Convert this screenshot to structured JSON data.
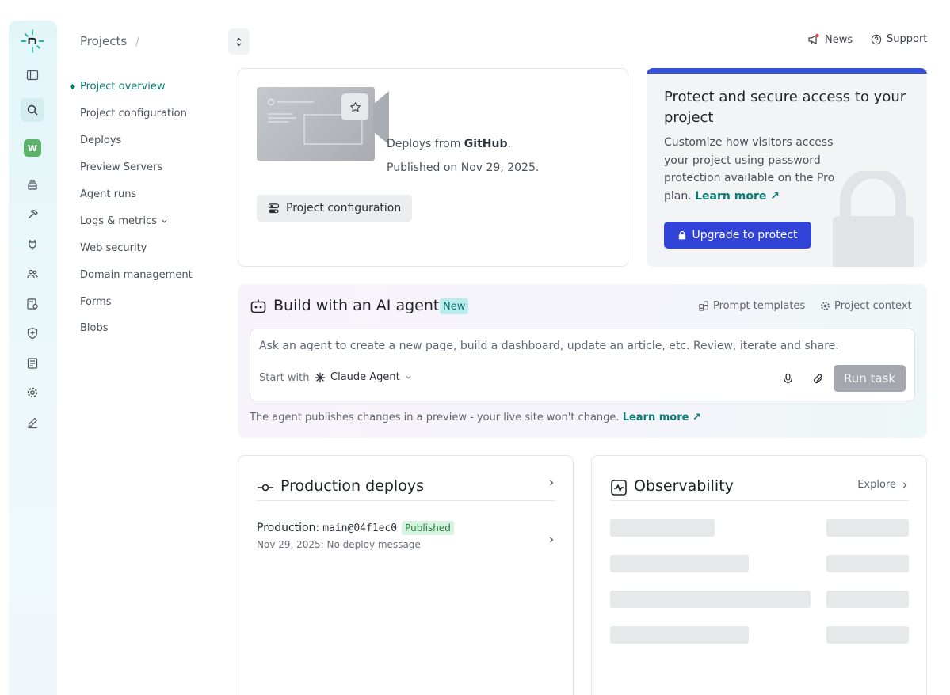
{
  "header": {
    "breadcrumb": "Projects",
    "breadcrumb_sep": "/",
    "news": "News",
    "support": "Support"
  },
  "nav": {
    "items": [
      "Project overview",
      "Project configuration",
      "Deploys",
      "Preview Servers",
      "Agent runs",
      "Logs & metrics",
      "Web security",
      "Domain management",
      "Forms",
      "Blobs"
    ]
  },
  "rail": {
    "avatar_letter": "W"
  },
  "overview": {
    "deploys_from_prefix": "Deploys from ",
    "deploys_from_source": "GitHub",
    "deploys_from_suffix": ".",
    "published": "Published on Nov 29, 2025.",
    "config_button": "Project configuration"
  },
  "protect": {
    "title": "Protect and secure access to your project",
    "desc": "Customize how visitors access your project using password protection available on the Pro plan.",
    "learn_more": "Learn more ↗",
    "button": "Upgrade to protect",
    "accent": "#3552d8"
  },
  "ai": {
    "title": "Build with an AI agent",
    "badge": "New",
    "prompt_templates": "Prompt templates",
    "project_context": "Project context",
    "placeholder": "Ask an agent to create a new page, build a dashboard, update an article, etc. Review, iterate and share.",
    "start_with": "Start with",
    "agent": "Claude Agent",
    "run_button": "Run task",
    "footer_text": "The agent publishes changes in a preview - your live site won't change.",
    "footer_link": "Learn more ↗"
  },
  "production": {
    "title": "Production deploys",
    "label": "Production:",
    "ref": "main@04f1ec0",
    "status": "Published",
    "message": "Nov 29, 2025: No deploy message"
  },
  "observability": {
    "title": "Observability",
    "explore": "Explore"
  },
  "colors": {
    "brand_teal": "#0c7c74",
    "primary_blue": "#3243d8"
  }
}
